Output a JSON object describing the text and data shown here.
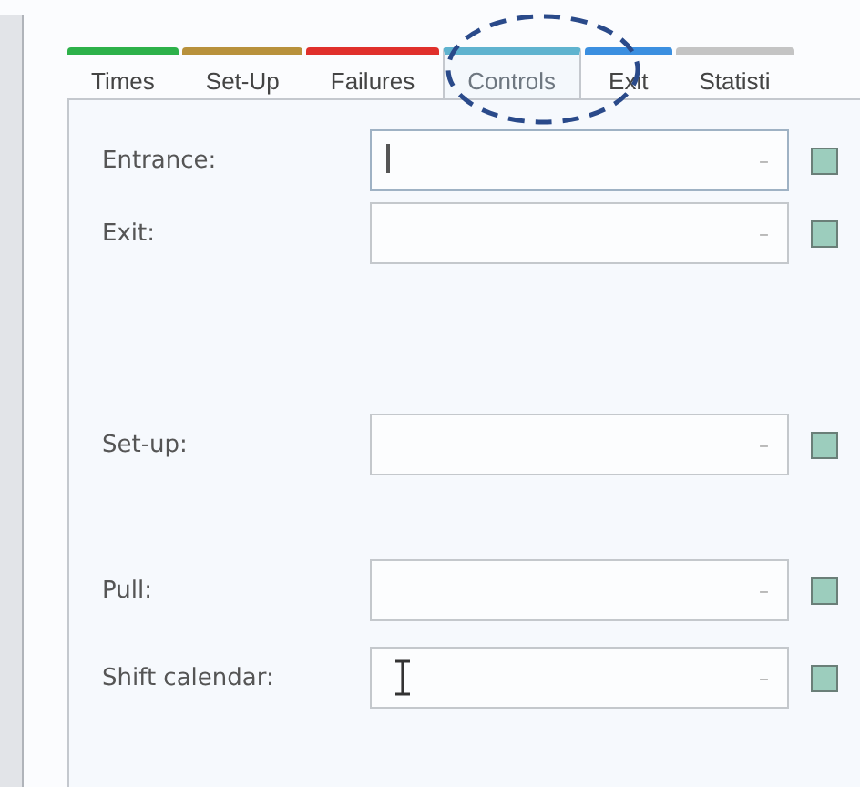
{
  "tabs": [
    {
      "label": "Times",
      "color": "#2db14a",
      "selected": false
    },
    {
      "label": "Set-Up",
      "color": "#b8913c",
      "selected": false
    },
    {
      "label": "Failures",
      "color": "#e0302c",
      "selected": false
    },
    {
      "label": "Controls",
      "color": "#5fb3cf",
      "selected": true
    },
    {
      "label": "Exit",
      "color": "#3b8fe0",
      "selected": false
    },
    {
      "label": "Statisti",
      "color": "#c4c4c4",
      "selected": false
    }
  ],
  "fields": [
    {
      "label": "Entrance:",
      "button": "–",
      "focused": true,
      "hovered": false,
      "checked": false
    },
    {
      "label": "Exit:",
      "button": "–",
      "focused": false,
      "hovered": false,
      "checked": false
    },
    {
      "label": "Set-up:",
      "button": "–",
      "focused": false,
      "hovered": false,
      "checked": false
    },
    {
      "label": "Pull:",
      "button": "–",
      "focused": false,
      "hovered": false,
      "checked": false
    },
    {
      "label": "Shift calendar:",
      "button": "–",
      "focused": false,
      "hovered": true,
      "checked": false
    }
  ],
  "annotation": {
    "kind": "dashed-ellipse"
  }
}
